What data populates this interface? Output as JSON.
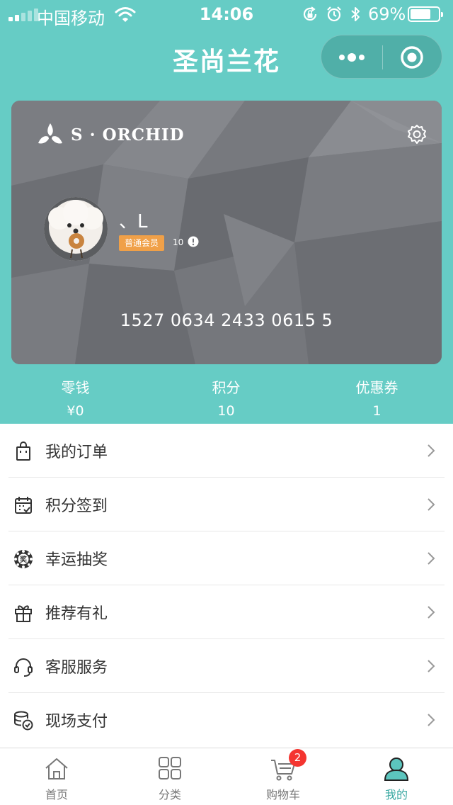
{
  "status_bar": {
    "carrier": "中国移动",
    "time": "14:06",
    "battery_percent": "69%",
    "battery_level": 0.69,
    "icons": [
      "signal-icon",
      "wifi-icon",
      "orientation-lock-icon",
      "alarm-icon",
      "bluetooth-icon",
      "battery-icon"
    ]
  },
  "nav": {
    "title": "圣尚兰花",
    "more_icon": "more-dots-icon",
    "close_icon": "target-close-icon"
  },
  "card": {
    "brand": "S · ORCHID",
    "username": "、L",
    "level": "普通会员",
    "points": "10",
    "card_number": "1527 0634 2433 0615 5",
    "background_color": "#727479"
  },
  "stats": [
    {
      "label": "零钱",
      "value": "¥0"
    },
    {
      "label": "积分",
      "value": "10"
    },
    {
      "label": "优惠券",
      "value": "1"
    }
  ],
  "menu": [
    {
      "label": "我的订单",
      "icon": "shopping-bag-icon"
    },
    {
      "label": "积分签到",
      "icon": "calendar-check-icon"
    },
    {
      "label": "幸运抽奖",
      "icon": "lottery-wheel-icon",
      "icon_text": "奖"
    },
    {
      "label": "推荐有礼",
      "icon": "gift-icon"
    },
    {
      "label": "客服服务",
      "icon": "headset-icon"
    },
    {
      "label": "现场支付",
      "icon": "coins-payment-icon"
    }
  ],
  "tabbar": {
    "tabs": [
      {
        "label": "首页",
        "icon": "home-icon"
      },
      {
        "label": "分类",
        "icon": "grid-icon"
      },
      {
        "label": "购物车",
        "icon": "cart-icon"
      },
      {
        "label": "我的",
        "icon": "user-icon"
      }
    ],
    "active_index": 3,
    "cart_badge": "2",
    "active_color": "#3aa8a2"
  },
  "colors": {
    "header": "#66ccc5",
    "level_badge": "#f0a048",
    "badge": "#f43530"
  }
}
